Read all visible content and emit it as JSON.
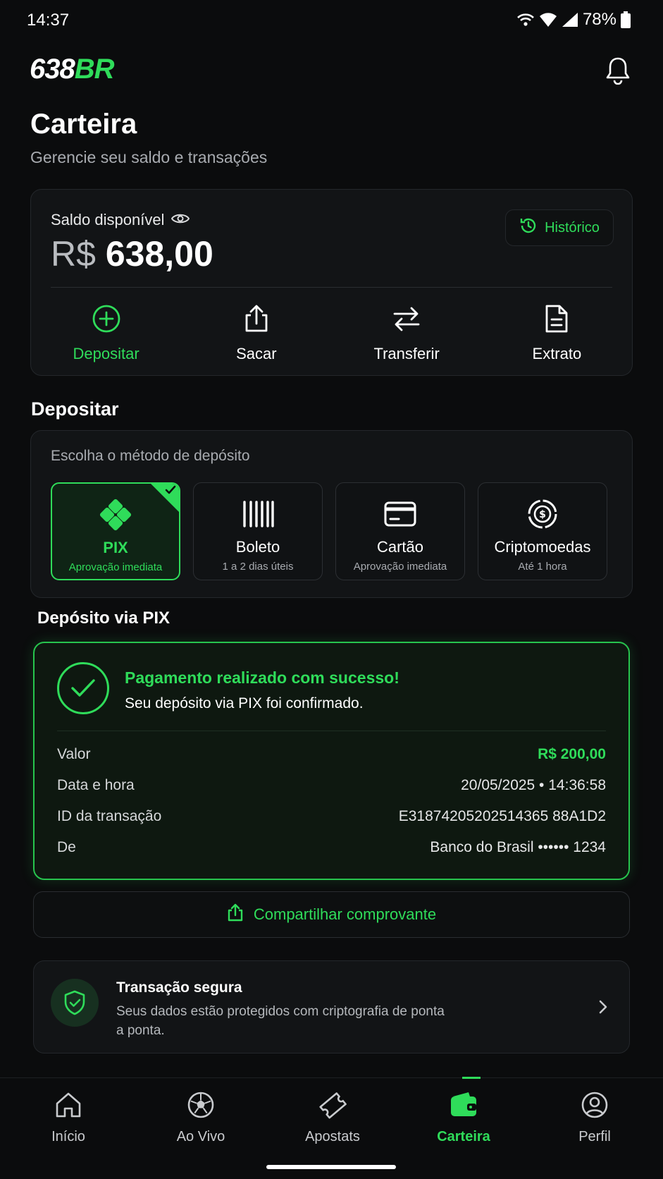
{
  "status_bar": {
    "time": "14:37",
    "battery": "78%"
  },
  "header": {
    "logo_white": "638",
    "logo_green": "BR"
  },
  "page": {
    "title": "Carteira",
    "subtitle": "Gerencie seu saldo e transações"
  },
  "balance": {
    "label": "Saldo disponível",
    "currency": "R$",
    "amount": "638,00",
    "history_label": "Histórico",
    "actions": [
      {
        "label": "Depositar",
        "icon": "plus-circle-icon",
        "active": true
      },
      {
        "label": "Sacar",
        "icon": "upload-icon",
        "active": false
      },
      {
        "label": "Transferir",
        "icon": "transfer-arrows-icon",
        "active": false
      },
      {
        "label": "Extrato",
        "icon": "document-icon",
        "active": false
      }
    ]
  },
  "deposit": {
    "section_title": "Depositar",
    "hint": "Escolha o método de depósito",
    "methods": [
      {
        "name": "PIX",
        "sub": "Aprovação imediata",
        "icon": "pix-icon",
        "selected": true
      },
      {
        "name": "Boleto",
        "sub": "1 a 2 dias úteis",
        "icon": "barcode-icon",
        "selected": false
      },
      {
        "name": "Cartão",
        "sub": "Aprovação imediata",
        "icon": "card-icon",
        "selected": false
      },
      {
        "name": "Criptomoedas",
        "sub": "Até 1 hora",
        "icon": "crypto-icon",
        "selected": false
      }
    ]
  },
  "pix": {
    "title": "Depósito via PIX",
    "success_title": "Pagamento realizado com sucesso!",
    "success_sub": "Seu depósito via PIX foi confirmado.",
    "rows": [
      {
        "key": "Valor",
        "value": "R$ 200,00"
      },
      {
        "key": "Data e hora",
        "value": "20/05/2025 • 14:36:58"
      },
      {
        "key": "ID da transação",
        "value": "E31874205202514365 88A1D2"
      },
      {
        "key": "De",
        "value": "Banco do Brasil •••••• 1234"
      }
    ],
    "share_label": "Compartilhar comprovante"
  },
  "secure": {
    "title": "Transação segura",
    "text": "Seus dados estão protegidos com criptografia de ponta a ponta."
  },
  "nav": {
    "items": [
      {
        "label": "Início",
        "icon": "home-icon",
        "active": false
      },
      {
        "label": "Ao Vivo",
        "icon": "soccer-ball-icon",
        "active": false
      },
      {
        "label": "Apostats",
        "icon": "ticket-icon",
        "active": false
      },
      {
        "label": "Carteira",
        "icon": "wallet-icon",
        "active": true
      },
      {
        "label": "Perfil",
        "icon": "user-icon",
        "active": false
      }
    ]
  },
  "colors": {
    "accent": "#2fdc5a",
    "background": "#0b0c0d",
    "card": "#121416"
  }
}
